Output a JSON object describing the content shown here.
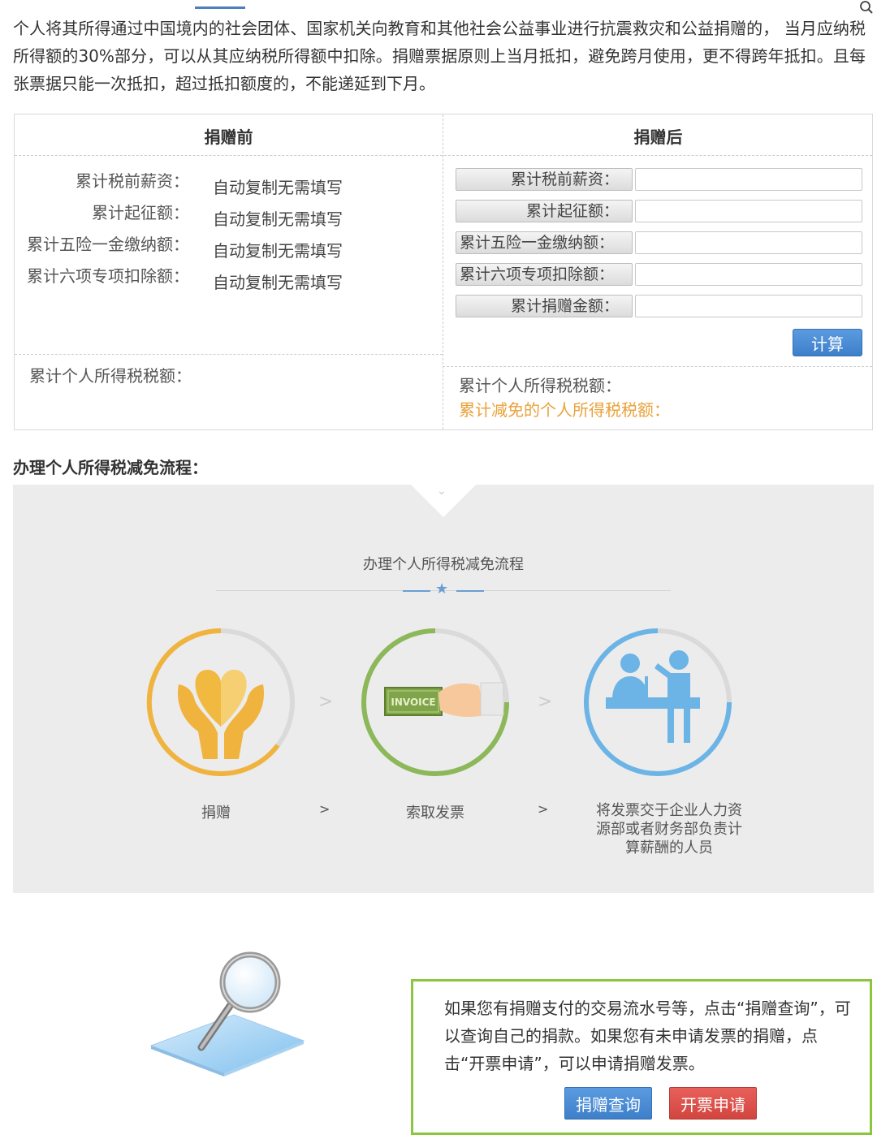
{
  "intro": {
    "text": "个人将其所得通过中国境内的社会团体、国家机关向教育和其他社会公益事业进行抗震救灾和公益捐赠的， 当月应纳税所得额的30%部分，可以从其应纳税所得额中扣除。捐赠票据原则上当月抵扣，避免跨月使用，更不得跨年抵扣。且每张票据只能一次抵扣，超过抵扣额度的，不能递延到下月。"
  },
  "calculator": {
    "before_header": "捐赠前",
    "after_header": "捐赠后",
    "before_rows": [
      {
        "label": "累计税前薪资：",
        "value": "自动复制无需填写"
      },
      {
        "label": "累计起征额：",
        "value": "自动复制无需填写"
      },
      {
        "label": "累计五险一金缴纳额：",
        "value": "自动复制无需填写"
      },
      {
        "label": "累计六项专项扣除额：",
        "value": "自动复制无需填写"
      }
    ],
    "after_rows": [
      {
        "label": "累计税前薪资：",
        "value": ""
      },
      {
        "label": "累计起征额：",
        "value": ""
      },
      {
        "label": "累计五险一金缴纳额：",
        "value": ""
      },
      {
        "label": "累计六项专项扣除额：",
        "value": ""
      },
      {
        "label": "累计捐赠金额：",
        "value": ""
      }
    ],
    "calc_button": "计算",
    "before_result_label": "累计个人所得税税额：",
    "after_result_label": "累计个人所得税税额：",
    "after_reduced_label": "累计减免的个人所得税税额："
  },
  "process": {
    "section_heading": "办理个人所得税减免流程：",
    "title": "办理个人所得税减免流程",
    "invoice_text": "INVOICE",
    "steps": [
      {
        "label": "捐赠",
        "icon": "heart-hands-icon"
      },
      {
        "label": "索取发票",
        "icon": "invoice-hand-icon"
      },
      {
        "label": "将发票交于企业人力资源部或者财务部负责计算薪酬的人员",
        "icon": "reception-desk-icon"
      }
    ],
    "step_label_lines": [
      "将发票交于企业人力资",
      "源部或者财务部负责计",
      "算薪酬的人员"
    ],
    "separator": ">"
  },
  "info": {
    "text": "如果您有捐赠支付的交易流水号等，点击“捐赠查询”，可以查询自己的捐款。如果您有未申请发票的捐赠，点击“开票申请”，可以申请捐赠发票。",
    "query_button": "捐赠查询",
    "invoice_button": "开票申请"
  },
  "colors": {
    "accent_blue": "#4b8fd6",
    "orange": "#e9a23b",
    "green_border": "#8cc63f",
    "red_button": "#d9504a"
  }
}
